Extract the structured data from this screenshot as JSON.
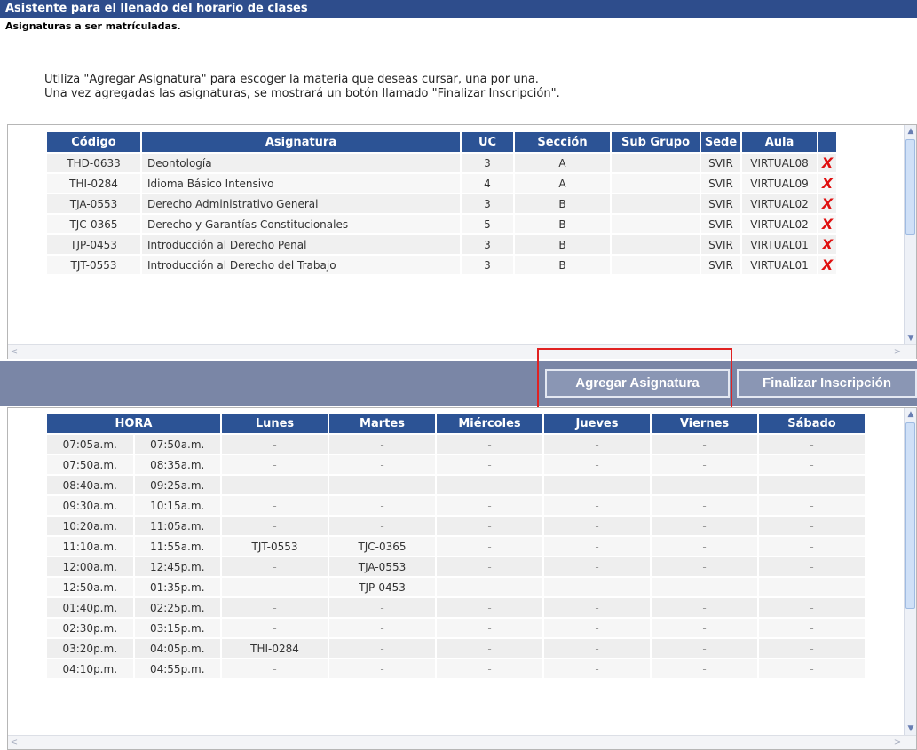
{
  "window": {
    "title": "Asistente para el llenado del horario de clases",
    "subtitle": "Asignaturas a ser matrículadas."
  },
  "instructions": {
    "line1": "Utiliza \"Agregar Asignatura\" para escoger la materia que deseas cursar, una por una.",
    "line2": "Una vez agregadas las asignaturas, se mostrará un botón llamado \"Finalizar Inscripción\"."
  },
  "subjects_table": {
    "headers": [
      "Código",
      "Asignatura",
      "UC",
      "Sección",
      "Sub Grupo",
      "Sede",
      "Aula",
      ""
    ],
    "rows": [
      [
        "THD-0633",
        "Deontología",
        "3",
        "A",
        "",
        "SVIR",
        "VIRTUAL08"
      ],
      [
        "THI-0284",
        "Idioma Básico Intensivo",
        "4",
        "A",
        "",
        "SVIR",
        "VIRTUAL09"
      ],
      [
        "TJA-0553",
        "Derecho Administrativo General",
        "3",
        "B",
        "",
        "SVIR",
        "VIRTUAL02"
      ],
      [
        "TJC-0365",
        "Derecho y Garantías Constitucionales",
        "5",
        "B",
        "",
        "SVIR",
        "VIRTUAL02"
      ],
      [
        "TJP-0453",
        "Introducción al Derecho Penal",
        "3",
        "B",
        "",
        "SVIR",
        "VIRTUAL01"
      ],
      [
        "TJT-0553",
        "Introducción al Derecho del Trabajo",
        "3",
        "B",
        "",
        "SVIR",
        "VIRTUAL01"
      ]
    ],
    "delete_glyph": "X"
  },
  "toolbar": {
    "add_label": "Agregar Asignatura",
    "finish_label": "Finalizar Inscripción"
  },
  "schedule_table": {
    "headers": [
      "HORA",
      "Lunes",
      "Martes",
      "Miércoles",
      "Jueves",
      "Viernes",
      "Sábado"
    ],
    "rows": [
      [
        "07:05a.m.",
        "07:50a.m.",
        "-",
        "-",
        "-",
        "-",
        "-",
        "-"
      ],
      [
        "07:50a.m.",
        "08:35a.m.",
        "-",
        "-",
        "-",
        "-",
        "-",
        "-"
      ],
      [
        "08:40a.m.",
        "09:25a.m.",
        "-",
        "-",
        "-",
        "-",
        "-",
        "-"
      ],
      [
        "09:30a.m.",
        "10:15a.m.",
        "-",
        "-",
        "-",
        "-",
        "-",
        "-"
      ],
      [
        "10:20a.m.",
        "11:05a.m.",
        "-",
        "-",
        "-",
        "-",
        "-",
        "-"
      ],
      [
        "11:10a.m.",
        "11:55a.m.",
        "TJT-0553",
        "TJC-0365",
        "-",
        "-",
        "-",
        "-"
      ],
      [
        "12:00a.m.",
        "12:45p.m.",
        "-",
        "TJA-0553",
        "-",
        "-",
        "-",
        "-"
      ],
      [
        "12:50a.m.",
        "01:35p.m.",
        "-",
        "TJP-0453",
        "-",
        "-",
        "-",
        "-"
      ],
      [
        "01:40p.m.",
        "02:25p.m.",
        "-",
        "-",
        "-",
        "-",
        "-",
        "-"
      ],
      [
        "02:30p.m.",
        "03:15p.m.",
        "-",
        "-",
        "-",
        "-",
        "-",
        "-"
      ],
      [
        "03:20p.m.",
        "04:05p.m.",
        "THI-0284",
        "-",
        "-",
        "-",
        "-",
        "-"
      ],
      [
        "04:10p.m.",
        "04:55p.m.",
        "-",
        "-",
        "-",
        "-",
        "-",
        "-"
      ]
    ]
  },
  "colors": {
    "title_bar": "#2e4d8c",
    "header": "#2c5395",
    "toolbar": "#7a86a6",
    "delete": "#e01010",
    "highlight": "#e02222"
  }
}
